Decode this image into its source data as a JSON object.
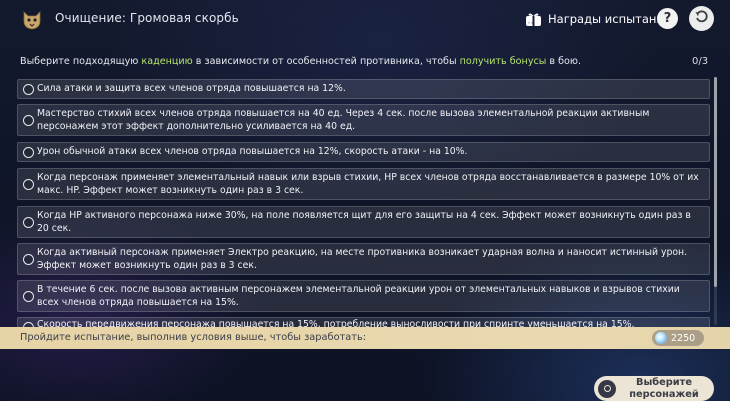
{
  "header": {
    "title": "Очищение: Громовая скорбь",
    "rewards_label": "Награды испытания",
    "help_label": "?"
  },
  "instruction": {
    "part1": "Выберите подходящую ",
    "highlight1": "каденцию",
    "part2": " в зависимости от особенностей противника, чтобы ",
    "highlight2": "получить бонусы",
    "part3": " в бою.",
    "counter": "0/3",
    "highlight_color": "#b6e36c"
  },
  "options": [
    "Сила атаки и защита всех членов отряда повышается на 12%.",
    "Мастерство стихий всех членов отряда повышается на 40 ед. Через 4 сек. после вызова элементальной реакции активным персонажем этот эффект дополнительно усиливается на 40 ед.",
    "Урон обычной атаки всех членов отряда повышается на 12%, скорость атаки - на 10%.",
    "Когда персонаж применяет элементальный навык или взрыв стихии, HP всех членов отряда восстанавливается в размере 10% от их макс. HP. Эффект может возникнуть один раз в 3 сек.",
    "Когда HP активного персонажа ниже 30%, на поле появляется щит для его защиты на 4 сек. Эффект может возникнуть один раз в 20 сек.",
    "Когда активный персонаж применяет Электро реакцию, на месте противника возникает ударная волна и наносит истинный урон. Эффект может возникнуть один раз в 3 сек.",
    "В течение 6 сек. после вызова активным персонажем элементальной реакции урон от элементальных навыков и взрывов стихии всех членов отряда повышается на 15%.",
    "Скорость передвижения персонажа повышается на 15%, потребление выносливости при спринте уменьшается на 15%."
  ],
  "reward_bar": {
    "text": "Пройдите испытание, выполнив условия выше, чтобы заработать:",
    "amount": "2250",
    "icon": "primogem-icon"
  },
  "select_button": {
    "label": "Выберите персонажей"
  },
  "colors": {
    "reward_bar": "#e8d6ab",
    "accent_green": "#b6e36c",
    "select_button": "#ece5d5"
  }
}
